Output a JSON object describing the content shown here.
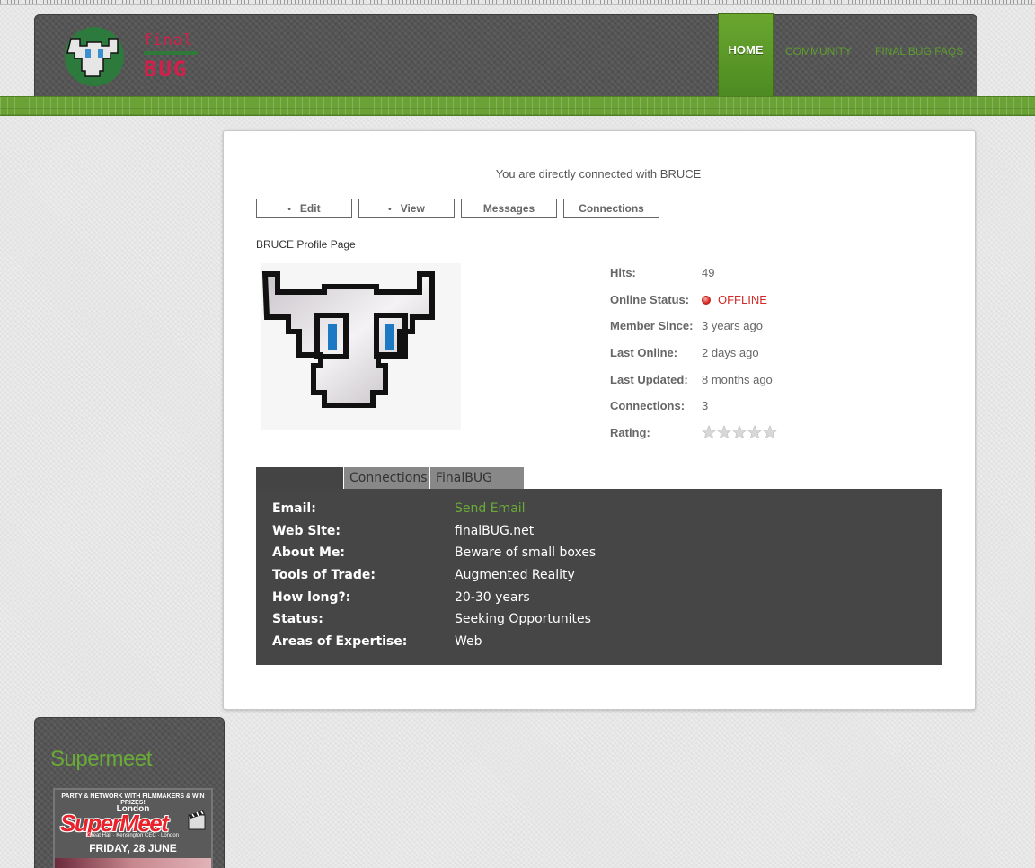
{
  "header": {
    "logo_final": "final",
    "logo_bug": "BUG",
    "nav": [
      "HOME",
      "COMMUNITY",
      "FINAL BUG FAQS"
    ]
  },
  "profile": {
    "connected_message": "You are directly connected with BRUCE",
    "actions": [
      "Edit",
      "View",
      "Messages",
      "Connections"
    ],
    "page_title": "BRUCE Profile Page",
    "stats": [
      {
        "label": "Hits:",
        "value": "49"
      },
      {
        "label": "Online Status:",
        "value": "OFFLINE"
      },
      {
        "label": "Member Since:",
        "value": "3 years ago"
      },
      {
        "label": "Last Online:",
        "value": "2 days ago"
      },
      {
        "label": "Last Updated:",
        "value": "8 months ago"
      },
      {
        "label": "Connections:",
        "value": "3"
      },
      {
        "label": "Rating:",
        "value": ""
      }
    ],
    "rating": 0,
    "rating_max": 5,
    "tabs": [
      "",
      "Connections",
      "FinalBUG Blog"
    ],
    "details": [
      {
        "label": "Email:",
        "value": "Send Email"
      },
      {
        "label": "Web Site:",
        "value": "finalBUG.net"
      },
      {
        "label": "About Me:",
        "value": "Beware of small boxes"
      },
      {
        "label": "Tools of Trade:",
        "value": "Augmented Reality"
      },
      {
        "label": "How long?:",
        "value": "20-30 years"
      },
      {
        "label": "Status:",
        "value": "Seeking Opportunites"
      },
      {
        "label": "Areas of Expertise:",
        "value": "Web"
      }
    ]
  },
  "sidebar": {
    "title": "Supermeet",
    "ad": {
      "tagline": "PARTY & NETWORK WITH FILMMAKERS & WIN PRIZES!",
      "city": "London",
      "brand": "SuperMeet",
      "venue": "Great Hall · Kensington CEC · London",
      "date": "FRIDAY, 28 JUNE"
    }
  },
  "colors": {
    "accent_green": "#6aab37",
    "offline_red": "#d12a2a",
    "header_gray": "#555555",
    "panel_gray": "#464646"
  }
}
